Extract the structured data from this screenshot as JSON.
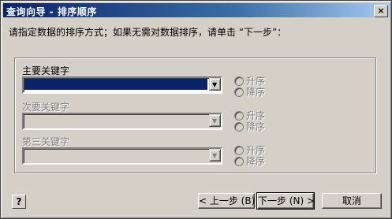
{
  "window": {
    "title": "查询向导 - 排序顺序",
    "close_label": "×"
  },
  "instruction": "请指定数据的排序方式；如果无需对数据排序，请单击 “下一步”：",
  "sort_keys": [
    {
      "label": "主要关键字",
      "value": "",
      "enabled": true,
      "asc_label": "升序",
      "desc_label": "降序"
    },
    {
      "label": "次要关键字",
      "value": "",
      "enabled": false,
      "asc_label": "升序",
      "desc_label": "降序"
    },
    {
      "label": "第三关键字",
      "value": "",
      "enabled": false,
      "asc_label": "升序",
      "desc_label": "降序"
    }
  ],
  "buttons": {
    "help": "?",
    "back": "< 上一步 (B)",
    "next": "下一步 (N) >",
    "cancel": "取消"
  },
  "colors": {
    "title_bar": "#0a246a",
    "selection": "#0a246a",
    "face": "#d4d0c8"
  }
}
